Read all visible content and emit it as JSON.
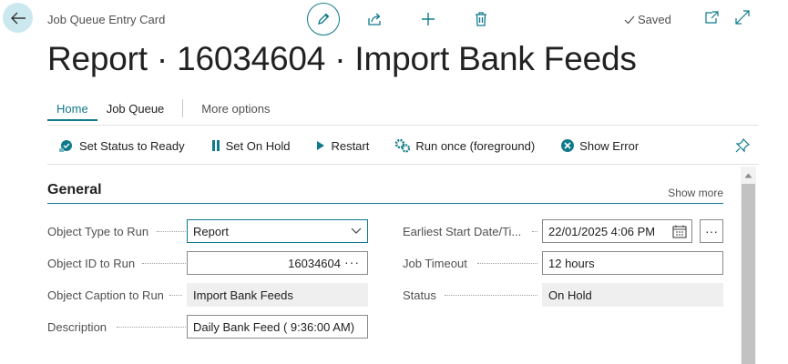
{
  "header": {
    "caption": "Job Queue Entry Card",
    "saved_label": "Saved",
    "title": "Report · 16034604 · Import Bank Feeds"
  },
  "tabs": [
    {
      "label": "Home",
      "active": true
    },
    {
      "label": "Job Queue",
      "active": false
    },
    {
      "label": "More options",
      "active": false
    }
  ],
  "actions": [
    {
      "label": "Set Status to Ready",
      "icon": "status-ready-icon"
    },
    {
      "label": "Set On Hold",
      "icon": "pause-icon"
    },
    {
      "label": "Restart",
      "icon": "play-icon"
    },
    {
      "label": "Run once (foreground)",
      "icon": "gears-icon"
    },
    {
      "label": "Show Error",
      "icon": "error-icon"
    }
  ],
  "section": {
    "title": "General",
    "show_more": "Show more"
  },
  "fields": {
    "object_type": {
      "label": "Object Type to Run",
      "value": "Report"
    },
    "object_id": {
      "label": "Object ID to Run",
      "value": "16034604"
    },
    "object_caption": {
      "label": "Object Caption to Run",
      "value": "Import Bank Feeds"
    },
    "description": {
      "label": "Description",
      "value": "Daily Bank Feed ( 9:36:00 AM)"
    },
    "earliest_start": {
      "label": "Earliest Start Date/Ti...",
      "value": "22/01/2025 4:06 PM"
    },
    "job_timeout": {
      "label": "Job Timeout",
      "value": "12 hours"
    },
    "status": {
      "label": "Status",
      "value": "On Hold"
    }
  },
  "colors": {
    "accent": "#0f7a8a",
    "back_button_bg": "#cbe8ee",
    "readonly_bg": "#efefef"
  }
}
